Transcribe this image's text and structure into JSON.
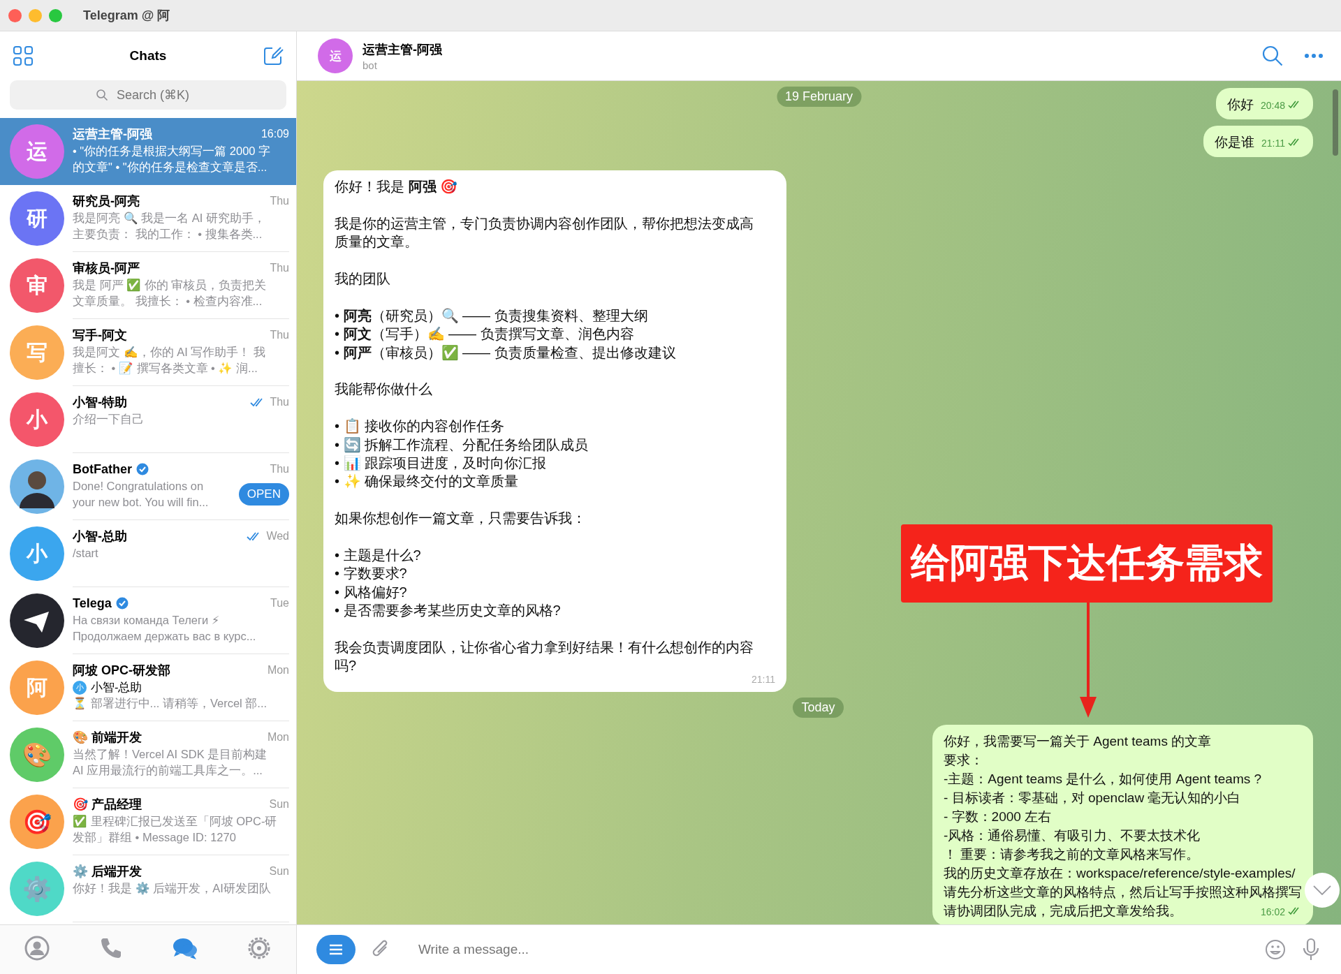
{
  "window": {
    "title": "Telegram @ 阿"
  },
  "sidebar": {
    "title": "Chats",
    "search": {
      "placeholder": "Search (⌘K)"
    },
    "chats": [
      {
        "avatar": {
          "kind": "letter",
          "text": "运",
          "color": "#d16be8"
        },
        "name": "运营主管-阿强",
        "time": "16:09",
        "selected": true,
        "read": false,
        "verified": false,
        "preview": [
          "• \"你的任务是根据大纲写一篇 2000 字",
          "的文章\" • \"你的任务是检查文章是否..."
        ]
      },
      {
        "avatar": {
          "kind": "letter",
          "text": "研",
          "color": "#6b74f4"
        },
        "name": "研究员-阿亮",
        "time": "Thu",
        "selected": false,
        "read": false,
        "verified": false,
        "preview": [
          "我是阿亮 🔍  我是一名 AI 研究助手，",
          "主要负责：  我的工作：  • 搜集各类..."
        ]
      },
      {
        "avatar": {
          "kind": "letter",
          "text": "审",
          "color": "#f2586b"
        },
        "name": "审核员-阿严",
        "time": "Thu",
        "selected": false,
        "read": false,
        "verified": false,
        "preview": [
          "我是 阿严 ✅  你的 审核员，负责把关",
          "文章质量。  我擅长：  • 检查内容准..."
        ]
      },
      {
        "avatar": {
          "kind": "letter",
          "text": "写",
          "color": "#fbad55"
        },
        "name": "写手-阿文",
        "time": "Thu",
        "selected": false,
        "read": false,
        "verified": false,
        "preview": [
          "我是阿文 ✍️，你的 AI 写作助手！  我",
          "擅长：  • 📝 撰写各类文章 • ✨ 润..."
        ]
      },
      {
        "avatar": {
          "kind": "letter",
          "text": "小",
          "color": "#f4566b"
        },
        "name": "小智-特助",
        "time": "Thu",
        "selected": false,
        "read": true,
        "verified": false,
        "preview": [
          "介绍一下自己"
        ]
      },
      {
        "avatar": {
          "kind": "photo",
          "color": "#6fb4e6"
        },
        "name": "BotFather",
        "time": "Thu",
        "selected": false,
        "read": false,
        "verified": true,
        "button": "OPEN",
        "preview": [
          "Done! Congratulations on",
          "your new bot. You will fin..."
        ]
      },
      {
        "avatar": {
          "kind": "letter",
          "text": "小",
          "color": "#3ba6ee"
        },
        "name": "小智-总助",
        "time": "Wed",
        "selected": false,
        "read": true,
        "verified": false,
        "preview": [
          "/start"
        ]
      },
      {
        "avatar": {
          "kind": "logo",
          "color": "#25262e"
        },
        "name": "Telega",
        "time": "Tue",
        "selected": false,
        "read": false,
        "verified": true,
        "preview": [
          "На связи команда Телеги ⚡",
          "Продолжаем держать вас в курс..."
        ]
      },
      {
        "avatar": {
          "kind": "letter",
          "text": "阿",
          "color": "#fba24c"
        },
        "name": "阿坡 OPC-研发部",
        "time": "Mon",
        "selected": false,
        "read": false,
        "verified": false,
        "sender": {
          "name": "小智-总助",
          "avatar": "小"
        },
        "preview": [
          "⏳ 部署进行中...  请稍等，Vercel 部..."
        ]
      },
      {
        "avatar": {
          "kind": "emoji",
          "text": "🎨",
          "color": "#5fcb68"
        },
        "name": "🎨 前端开发",
        "time": "Mon",
        "selected": false,
        "read": false,
        "verified": false,
        "preview": [
          "当然了解！Vercel AI SDK 是目前构建",
          "AI 应用最流行的前端工具库之一。..."
        ]
      },
      {
        "avatar": {
          "kind": "emoji",
          "text": "🎯",
          "color": "#fba24c"
        },
        "name": "🎯 产品经理",
        "time": "Sun",
        "selected": false,
        "read": false,
        "verified": false,
        "preview": [
          "✅ 里程碑汇报已发送至「阿坡 OPC-研",
          "发部」群组  • Message ID: 1270"
        ]
      },
      {
        "avatar": {
          "kind": "emoji",
          "text": "⚙️",
          "color": "#4fd9c7"
        },
        "name": "⚙️ 后端开发",
        "time": "Sun",
        "selected": false,
        "read": false,
        "verified": false,
        "preview": [
          "你好！我是 ⚙️ 后端开发，AI研发团队"
        ]
      }
    ],
    "tabs": [
      {
        "kind": "contacts",
        "selected": false
      },
      {
        "kind": "calls",
        "selected": false
      },
      {
        "kind": "chats",
        "selected": true
      },
      {
        "kind": "settings",
        "selected": false
      }
    ]
  },
  "chat": {
    "avatar": {
      "text": "运",
      "color": "#d16be8"
    },
    "title": "运营主管-阿强",
    "subtitle": "bot",
    "date_header": "19 February",
    "messages": [
      {
        "kind": "out",
        "lines": [
          "你好"
        ],
        "time": "20:48",
        "read": true
      },
      {
        "kind": "out",
        "lines": [
          "你是谁"
        ],
        "time": "21:11",
        "read": true
      },
      {
        "kind": "in",
        "time": "21:11",
        "paragraphs": [
          [
            "你好！我是 **阿强** 🎯"
          ],
          [
            "我是你的运营主管，专门负责协调内容创作团队，帮你把想法变成高质量的文章。"
          ],
          [
            "我的团队"
          ],
          [
            "• **阿亮**（研究员）🔍 —— 负责搜集资料、整理大纲",
            "• **阿文**（写手）✍️ —— 负责撰写文章、润色内容",
            "• **阿严**（审核员）✅ —— 负责质量检查、提出修改建议"
          ],
          [
            "我能帮你做什么"
          ],
          [
            "• 📋 接收你的内容创作任务",
            "• 🔄 拆解工作流程、分配任务给团队成员",
            "• 📊 跟踪项目进度，及时向你汇报",
            "• ✨ 确保最终交付的文章质量"
          ],
          [
            "如果你想创作一篇文章，只需要告诉我："
          ],
          [
            "• 主题是什么?",
            "• 字数要求?",
            "• 风格偏好?",
            "• 是否需要参考某些历史文章的风格?"
          ],
          [
            "我会负责调度团队，让你省心省力拿到好结果！有什么想创作的内容吗?"
          ]
        ]
      },
      {
        "kind": "date",
        "text": "Today"
      },
      {
        "kind": "out",
        "lines": [
          "你好，我需要写一篇关于 Agent teams 的文章",
          "要求：",
          "-主题：Agent teams 是什么，如何使用 Agent teams ?",
          "- 目标读者：零基础，对 openclaw 毫无认知的小白",
          "- 字数：2000 左右",
          "-风格：通俗易懂、有吸引力、不要太技术化",
          "！ 重要：请参考我之前的文章风格来写作。",
          "我的历史文章存放在：workspace/reference/style-examples/",
          "请先分析这些文章的风格特点，然后让写手按照这种风格撰写",
          "请协调团队完成，完成后把文章发给我。"
        ],
        "time": "16:02",
        "read": true
      }
    ],
    "annotation": {
      "text": "给阿强下达任务需求"
    },
    "composer": {
      "placeholder": "Write a message..."
    }
  }
}
